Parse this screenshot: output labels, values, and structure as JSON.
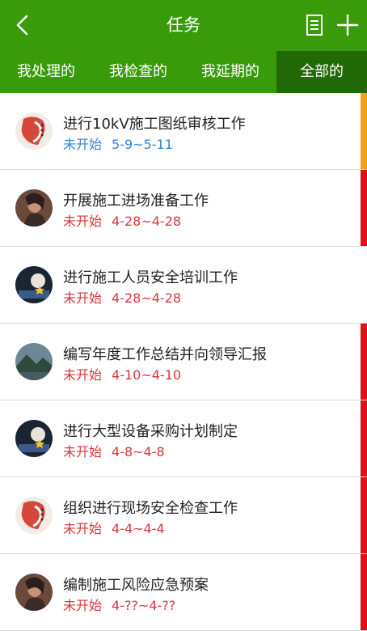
{
  "header": {
    "title": "任务",
    "back_icon": "back-arrow-icon",
    "doc_icon": "document-list-icon",
    "add_icon": "plus-icon"
  },
  "tabs": [
    {
      "label": "我处理的"
    },
    {
      "label": "我检查的"
    },
    {
      "label": "我延期的"
    },
    {
      "label": "全部的",
      "active": true
    }
  ],
  "colors": {
    "brand_green": "#3a9b0a",
    "tab_active": "#216806",
    "status_blue": "#2f86d6",
    "status_red": "#d9363a",
    "stripe_orange": "#f0a11b",
    "stripe_red": "#d8141e"
  },
  "tasks": [
    {
      "title": "进行10kV施工图纸审核工作",
      "status": "未开始",
      "dates": "5-9~5-11",
      "stripe": "orange",
      "avatar": "red-chat-logo"
    },
    {
      "title": "开展施工进场准备工作",
      "status": "未开始",
      "dates": "4-28~4-28",
      "stripe": "red",
      "avatar": "photo-person"
    },
    {
      "title": "进行施工人员安全培训工作",
      "status": "未开始",
      "dates": "4-28~4-28",
      "stripe": "none",
      "avatar": "photo-dark"
    },
    {
      "title": "编写年度工作总结并向领导汇报",
      "status": "未开始",
      "dates": "4-10~4-10",
      "stripe": "red",
      "avatar": "photo-landscape"
    },
    {
      "title": "进行大型设备采购计划制定",
      "status": "未开始",
      "dates": "4-8~4-8",
      "stripe": "red",
      "avatar": "photo-dark"
    },
    {
      "title": "组织进行现场安全检查工作",
      "status": "未开始",
      "dates": "4-4~4-4",
      "stripe": "red",
      "avatar": "red-chat-logo"
    },
    {
      "title": "编制施工风险应急预案",
      "status": "未开始",
      "dates": "4-??~4-??",
      "stripe": "red",
      "avatar": "photo-person"
    }
  ]
}
